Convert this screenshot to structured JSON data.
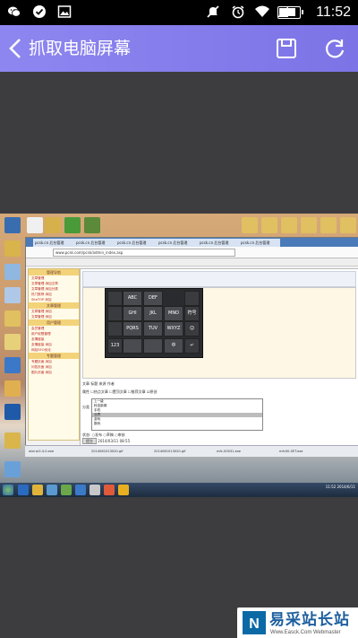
{
  "status_bar": {
    "time": "11:52",
    "battery_level": 0.85,
    "icons": [
      "wechat-icon",
      "check-circle-icon",
      "image-icon",
      "mute-icon",
      "alarm-icon",
      "wifi-icon",
      "signal-icon",
      "battery-icon"
    ]
  },
  "app_bar": {
    "title": "抓取电脑屏幕",
    "color_start": "#8e86f0",
    "color_end": "#7c74e6",
    "icons": [
      "back-arrow-icon",
      "save-icon",
      "refresh-icon"
    ]
  },
  "screenshot": {
    "browser": {
      "url": "www.pcsk.com/pcsk/admin_index.asp",
      "tabs": [
        "pcsk.cn 后台管理",
        "pcsk.cn 后台管理",
        "pcsk.cn 后台管理",
        "pcsk.cn 后台管理",
        "pcsk.cn 后台管理",
        "pcsk.cn 后台管理"
      ]
    },
    "sidebar": {
      "head": "管理导航",
      "items": [
        "文章管理",
        "文章管理  添加文章",
        "文章管理  添加分类",
        "热门推荐  添加",
        "SiteTOP  添加",
        "文章管理",
        "文章管理  添加",
        "文章管理  添加",
        "用户管理",
        "会员管理",
        "用户权限管理",
        "友情链接",
        "友情链接  添加",
        "网站SEO优化",
        "专题管理",
        "专题页面  添加",
        "问答页面  添加",
        "图片页面  添加"
      ]
    },
    "ime_keys": [
      "ABC",
      "DEF",
      "GHI",
      "JKL",
      "MNO",
      "PQRS",
      "TUV",
      "WXYZ",
      "123"
    ],
    "ime_side_keys": [
      "符号",
      "重输",
      "☺",
      "↵",
      "中"
    ],
    "form": {
      "row1": "文章 标题    来源    作者",
      "row2": "属性  ☐热点文章  ☐置顶文章  ☐推荐文章  ☑原创",
      "row3": "分类",
      "status_label": "状态:",
      "status_options": "○发布  ○草稿  ○审核",
      "submit": "提交",
      "date": "2014/03/11 08:55"
    },
    "list_options": [
      "上一级",
      "科技新闻",
      "手机",
      "业界",
      "游戏",
      "数码",
      "软件"
    ],
    "downloads": [
      "winrar2.4.0.exe",
      "2014061013020.gif",
      "2014061013020.gif",
      "mfc-00031.exe",
      "mfc00-SET.exe"
    ],
    "clock": "11:52\n2014/6/11"
  },
  "watermark": {
    "logo_label": "N",
    "title": "易采站长站",
    "subtitle": "Www.Easck.Com Webmaster"
  }
}
